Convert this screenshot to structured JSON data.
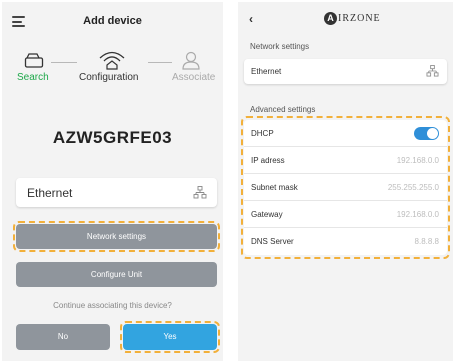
{
  "left": {
    "title": "Add device",
    "steps": [
      {
        "label": "Search",
        "color": "#1ea84a"
      },
      {
        "label": "Configuration",
        "color": "#333333"
      },
      {
        "label": "Associate",
        "color": "#aaaaaa"
      }
    ],
    "device_code": "AZW5GRFE03",
    "connection_field": {
      "value": "Ethernet",
      "icon": "ethernet-network-icon"
    },
    "buttons": {
      "network_settings": "Network settings",
      "configure_unit": "Configure Unit",
      "no": "No",
      "yes": "Yes"
    },
    "question": "Continue associating this device?"
  },
  "right": {
    "back_icon": "back-chevron-icon",
    "brand": {
      "letter": "A",
      "text": "IRZONE"
    },
    "network_section": {
      "title": "Network settings",
      "field": "Ethernet",
      "icon": "ethernet-network-icon"
    },
    "advanced_section": {
      "title": "Advanced settings",
      "dhcp": {
        "label": "DHCP",
        "enabled": true
      },
      "rows": [
        {
          "label": "IP adress",
          "value": "192.168.0.0"
        },
        {
          "label": "Subnet mask",
          "value": "255.255.255.0"
        },
        {
          "label": "Gateway",
          "value": "192.168.0.0"
        },
        {
          "label": "DNS Server",
          "value": "8.8.8.8"
        }
      ]
    }
  },
  "colors": {
    "highlight_dash": "#f2b03a",
    "accent_blue": "#32a4e0",
    "button_grey": "#8f959c",
    "search_green": "#1ea84a",
    "toggle_blue": "#2f8fd8"
  }
}
